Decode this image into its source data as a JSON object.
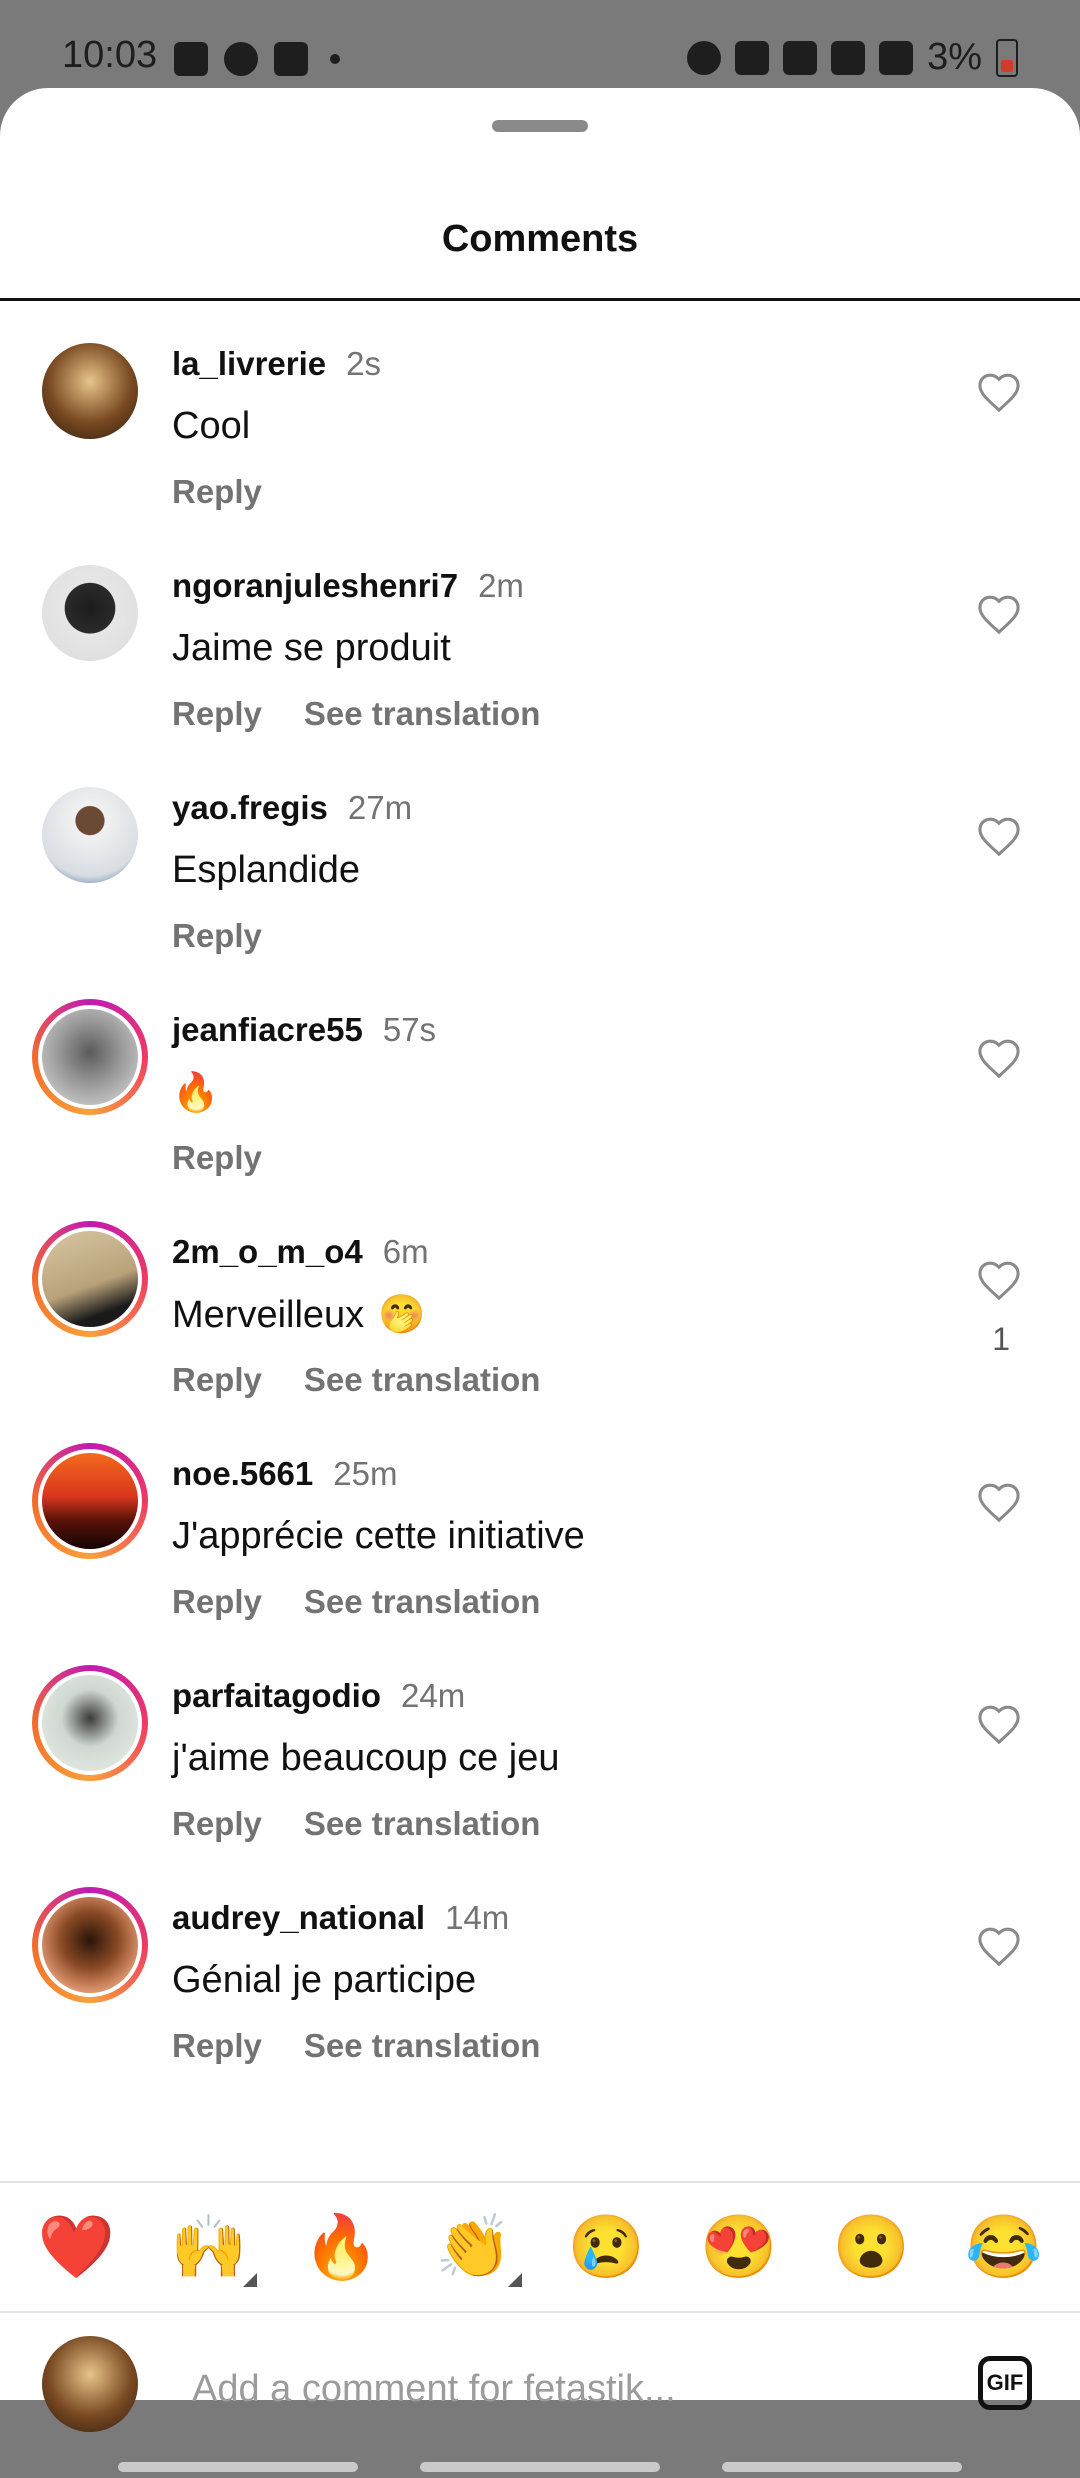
{
  "status_bar": {
    "time": "10:03",
    "battery": "3%"
  },
  "sheet": {
    "title": "Comments"
  },
  "comments": [
    {
      "username": "la_livrerie",
      "time": "2s",
      "text": "Cool",
      "reply": "Reply",
      "translation": "",
      "likes": ""
    },
    {
      "username": "ngoranjuleshenri7",
      "time": "2m",
      "text": "Jaime se produit",
      "reply": "Reply",
      "translation": "See translation",
      "likes": ""
    },
    {
      "username": "yao.fregis",
      "time": "27m",
      "text": "Esplandide",
      "reply": "Reply",
      "translation": "",
      "likes": ""
    },
    {
      "username": "jeanfiacre55",
      "time": "57s",
      "text": "🔥",
      "reply": "Reply",
      "translation": "",
      "likes": ""
    },
    {
      "username": "2m_o_m_o4",
      "time": "6m",
      "text": "Merveilleux",
      "emoji": "🤭",
      "reply": "Reply",
      "translation": "See translation",
      "likes": "1"
    },
    {
      "username": "noe.5661",
      "time": "25m",
      "text": "J'apprécie cette initiative",
      "reply": "Reply",
      "translation": "See translation",
      "likes": ""
    },
    {
      "username": "parfaitagodio",
      "time": "24m",
      "text": "j'aime beaucoup ce jeu",
      "reply": "Reply",
      "translation": "See translation",
      "likes": ""
    },
    {
      "username": "audrey_national",
      "time": "14m",
      "text": "Génial je participe",
      "reply": "Reply",
      "translation": "See translation",
      "likes": ""
    }
  ],
  "emoji_bar": [
    "❤️",
    "🙌",
    "🔥",
    "👏",
    "😢",
    "😍",
    "😮",
    "😂"
  ],
  "composer": {
    "placeholder": "Add a comment for fetastik...",
    "gif_label": "GIF"
  },
  "colors": {
    "username": "#111111",
    "muted": "#737373",
    "story_ring": "#c01bb4"
  }
}
